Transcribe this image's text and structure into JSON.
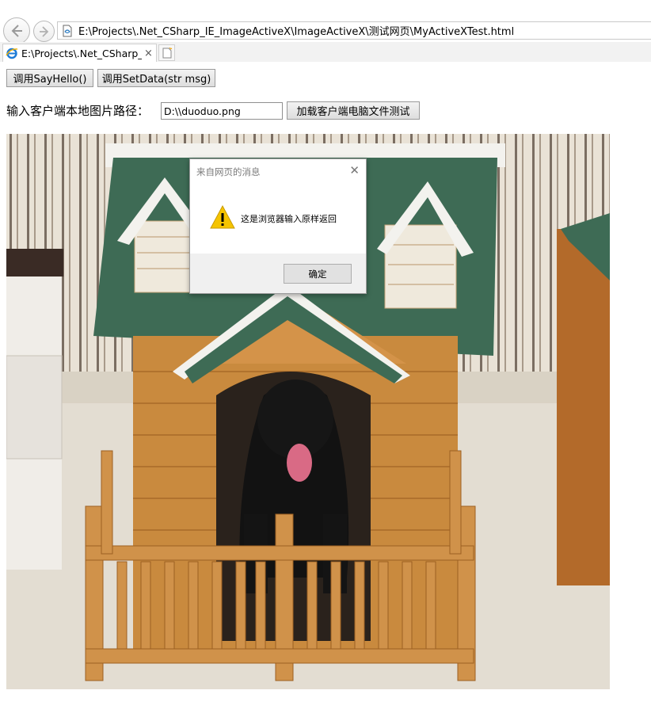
{
  "browser": {
    "address": "E:\\Projects\\.Net_CSharp_IE_ImageActiveX\\ImageActiveX\\测试网页\\MyActiveXTest.html",
    "tab_title": "E:\\Projects\\.Net_CSharp_I...",
    "tab_close": "×",
    "icons": [
      "back-arrow-icon",
      "forward-arrow-icon",
      "page-icon",
      "ie-logo-icon",
      "new-tab-icon"
    ]
  },
  "page": {
    "btn_say_hello": "调用SayHello()",
    "btn_set_data": "调用SetData(str msg)",
    "path_label": "输入客户端本地图片路径：",
    "path_value": "D:\\\\duoduo.png",
    "btn_load": "加载客户端电脑文件测试"
  },
  "dialog": {
    "title": "来自网页的消息",
    "close": "✕",
    "message": "这是浏览器输入原样返回",
    "ok_label": "确定",
    "icon": "warning-icon"
  },
  "colors": {
    "roof_green": "#3e6b55",
    "wood": "#c98a3e",
    "dialog_footer": "#f0f0f0"
  }
}
